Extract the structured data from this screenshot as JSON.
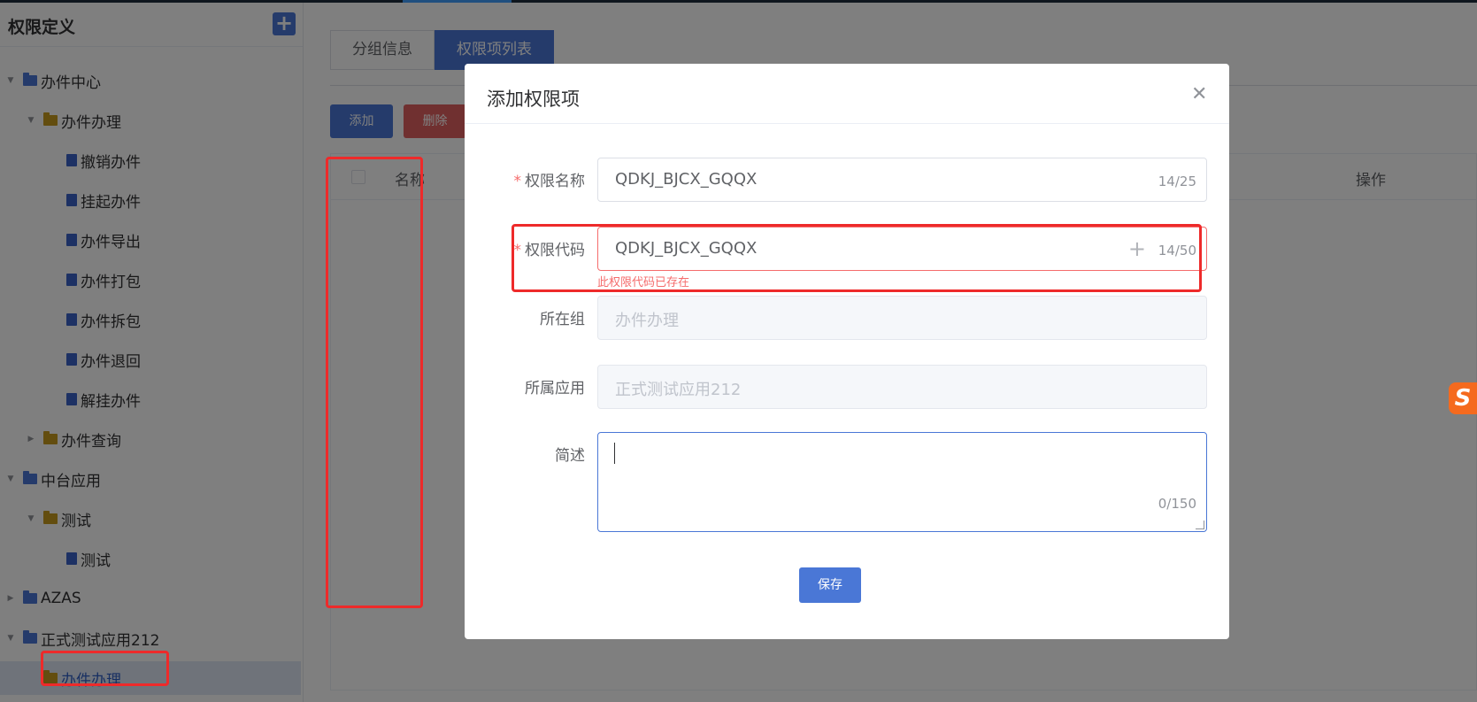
{
  "sidebar": {
    "title": "权限定义",
    "add_icon": "plus-icon",
    "items": [
      {
        "label": "办件中心",
        "arrow": "▼",
        "icon": "folder-open-icon"
      },
      {
        "label": "办件办理",
        "arrow": "▼",
        "icon": "folder-open-icon"
      },
      {
        "label": "撤销办件",
        "icon": "file-icon"
      },
      {
        "label": "挂起办件",
        "icon": "file-icon"
      },
      {
        "label": "办件导出",
        "icon": "file-icon"
      },
      {
        "label": "办件打包",
        "icon": "file-icon"
      },
      {
        "label": "办件拆包",
        "icon": "file-icon"
      },
      {
        "label": "办件退回",
        "icon": "file-icon"
      },
      {
        "label": "解挂办件",
        "icon": "file-icon"
      },
      {
        "label": "办件查询",
        "arrow": "▶",
        "icon": "folder-icon"
      },
      {
        "label": "中台应用",
        "arrow": "▼",
        "icon": "folder-open-icon"
      },
      {
        "label": "测试",
        "arrow": "▼",
        "icon": "folder-open-icon"
      },
      {
        "label": "测试",
        "icon": "file-icon"
      },
      {
        "label": "AZAS",
        "arrow": "▶",
        "icon": "folder-icon"
      },
      {
        "label": "正式测试应用212",
        "arrow": "▼",
        "icon": "folder-open-icon"
      },
      {
        "label": "办件办理",
        "icon": "folder-open-icon",
        "selected": true
      }
    ]
  },
  "main": {
    "tabs": [
      {
        "label": "分组信息",
        "active": false
      },
      {
        "label": "权限项列表",
        "active": true
      }
    ],
    "add_label": "添加",
    "delete_label": "删除",
    "table": {
      "col_name": "名称",
      "col_op": "操作"
    }
  },
  "dialog": {
    "title": "添加权限项",
    "close_icon": "close-icon",
    "fields": {
      "name_label": "权限名称",
      "name_value": "QDKJ_BJCX_GQQX",
      "name_count": "14/25",
      "code_label": "权限代码",
      "code_value": "QDKJ_BJCX_GQQX",
      "code_count": "14/50",
      "code_error": "此权限代码已存在",
      "group_label": "所在组",
      "group_placeholder": "办件办理",
      "app_label": "所属应用",
      "app_placeholder": "正式测试应用212",
      "desc_label": "简述",
      "desc_count": "0/150"
    },
    "save_label": "保存"
  },
  "colors": {
    "primary": "#4a77d6",
    "danger": "#e06060",
    "error_text": "#f56c6c",
    "annotation": "#ee2a2a"
  }
}
